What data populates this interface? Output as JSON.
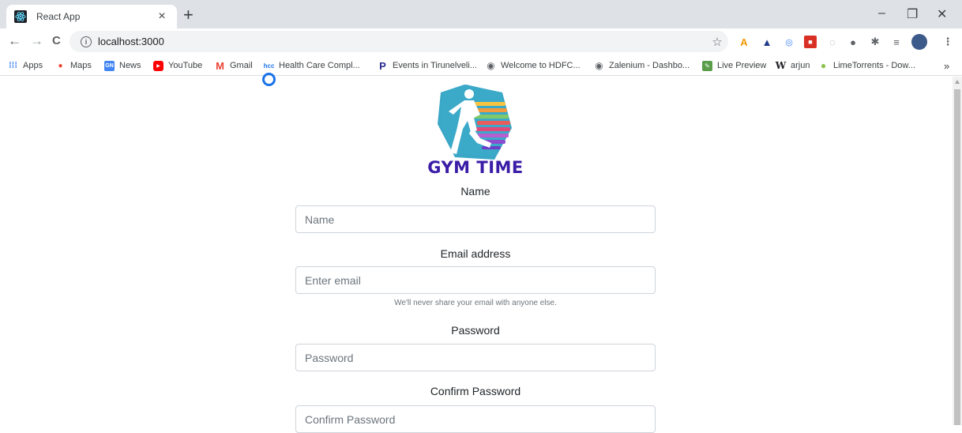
{
  "browser": {
    "tab_title": "React App",
    "tab_close": "×",
    "new_tab": "+",
    "minimize": "–",
    "restore": "❐",
    "close": "✕",
    "back": "←",
    "forward": "→",
    "reload": "C",
    "url": "localhost:3000",
    "bookmarks": [
      {
        "label": "Apps"
      },
      {
        "label": "Maps"
      },
      {
        "label": "News"
      },
      {
        "label": "YouTube"
      },
      {
        "label": "Gmail"
      },
      {
        "label": "Health Care Compl..."
      },
      {
        "label": "Events in Tirunelveli..."
      },
      {
        "label": "Welcome to HDFC..."
      },
      {
        "label": "Zalenium - Dashbo..."
      },
      {
        "label": "Live Preview"
      },
      {
        "label": "arjun"
      },
      {
        "label": "LimeTorrents - Dow..."
      }
    ],
    "more_bookmarks": "»"
  },
  "logo": {
    "text": "GYM TIME"
  },
  "form": {
    "name_label": "Name",
    "name_placeholder": "Name",
    "email_label": "Email address",
    "email_placeholder": "Enter email",
    "email_help": "We'll never share your email with anyone else.",
    "password_label": "Password",
    "password_placeholder": "Password",
    "confirm_label": "Confirm Password",
    "confirm_placeholder": "Confirm Password"
  },
  "colors": {
    "logo_text": "#3a1ca6",
    "logo_hex": "#3aa7c7",
    "focus_ring": "#1a73e8"
  }
}
